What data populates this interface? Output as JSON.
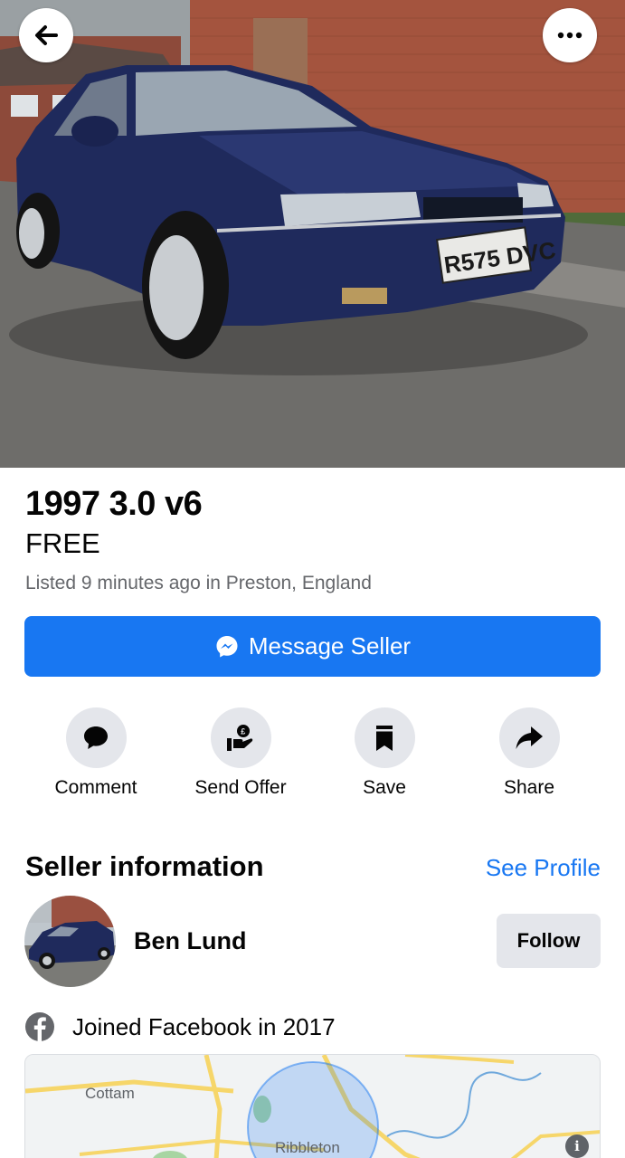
{
  "listing": {
    "title": "1997 3.0 v6",
    "price": "FREE",
    "listed": "Listed 9 minutes ago in Preston, England",
    "license_plate": "R575 DVC"
  },
  "primary_action": {
    "label": "Message Seller",
    "icon": "messenger-icon",
    "color": "#1877f2"
  },
  "actions": [
    {
      "label": "Comment",
      "icon": "comment-icon"
    },
    {
      "label": "Send Offer",
      "icon": "send-offer-icon"
    },
    {
      "label": "Save",
      "icon": "bookmark-icon"
    },
    {
      "label": "Share",
      "icon": "share-icon"
    }
  ],
  "seller": {
    "heading": "Seller information",
    "see_profile": "See Profile",
    "name": "Ben Lund",
    "follow": "Follow",
    "joined": "Joined Facebook in 2017"
  },
  "map": {
    "labels": [
      "Cottam",
      "Ribbleton"
    ],
    "info_icon": "i"
  },
  "header": {
    "back_icon": "arrow-left-icon",
    "more_icon": "more-dots-icon"
  },
  "colors": {
    "accent": "#1877f2",
    "button_grey": "#e4e6eb",
    "muted_text": "#65676b"
  }
}
